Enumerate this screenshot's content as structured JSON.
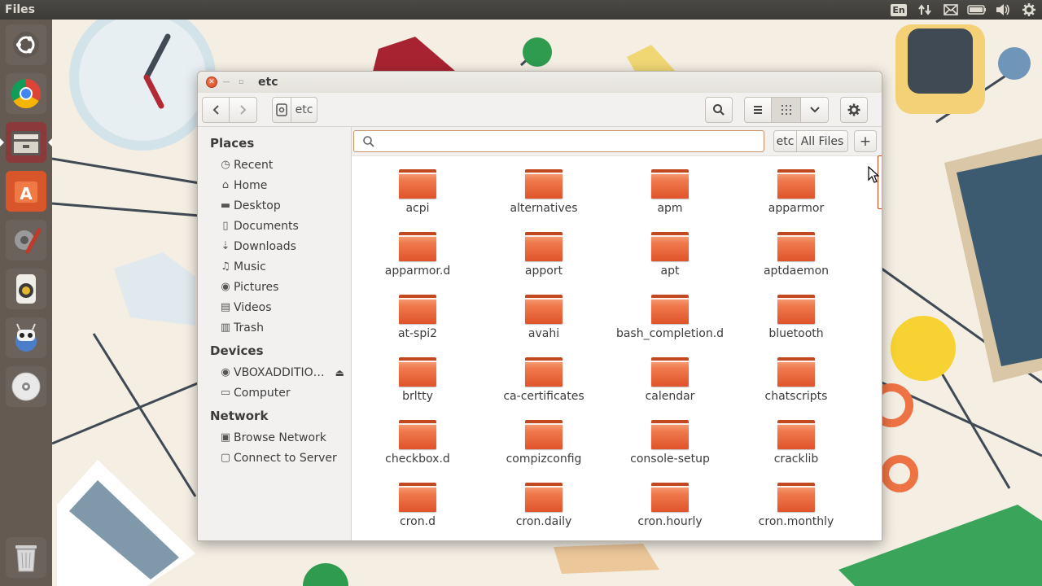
{
  "panel": {
    "app_name": "Files",
    "keyboard_layout": "En"
  },
  "panel_icons": [
    "transfer-arrows-icon",
    "mail-icon",
    "battery-icon",
    "volume-icon",
    "power-gear-icon"
  ],
  "launcher": {
    "items": [
      {
        "name": "ubuntu-dash-icon"
      },
      {
        "name": "chrome-icon"
      },
      {
        "name": "files-icon",
        "active": true
      },
      {
        "name": "software-center-icon"
      },
      {
        "name": "system-settings-icon"
      },
      {
        "name": "rhythmbox-icon"
      },
      {
        "name": "robot-app-icon"
      },
      {
        "name": "disc-icon"
      },
      {
        "name": "trash-launcher-icon"
      }
    ]
  },
  "window": {
    "title": "etc",
    "path_label": "etc"
  },
  "sidebar": {
    "places_heading": "Places",
    "places": [
      {
        "label": "Recent",
        "icon": "recent-icon"
      },
      {
        "label": "Home",
        "icon": "home-icon"
      },
      {
        "label": "Desktop",
        "icon": "desktop-icon"
      },
      {
        "label": "Documents",
        "icon": "documents-icon"
      },
      {
        "label": "Downloads",
        "icon": "downloads-icon"
      },
      {
        "label": "Music",
        "icon": "music-icon"
      },
      {
        "label": "Pictures",
        "icon": "pictures-icon"
      },
      {
        "label": "Videos",
        "icon": "videos-icon"
      },
      {
        "label": "Trash",
        "icon": "trash-icon"
      }
    ],
    "devices_heading": "Devices",
    "devices": [
      {
        "label": "VBOXADDITIO…",
        "icon": "optical-drive-icon"
      },
      {
        "label": "Computer",
        "icon": "computer-icon"
      }
    ],
    "network_heading": "Network",
    "network": [
      {
        "label": "Browse Network",
        "icon": "network-icon"
      },
      {
        "label": "Connect to Server",
        "icon": "server-icon"
      }
    ]
  },
  "search": {
    "placeholder": "",
    "scope_current": "etc",
    "scope_all": "All Files",
    "add_label": "+"
  },
  "files": [
    "acpi",
    "alternatives",
    "apm",
    "apparmor",
    "apparmor.d",
    "apport",
    "apt",
    "aptdaemon",
    "at-spi2",
    "avahi",
    "bash_completion.d",
    "bluetooth",
    "brltty",
    "ca-certificates",
    "calendar",
    "chatscripts",
    "checkbox.d",
    "compizconfig",
    "console-setup",
    "cracklib",
    "cron.d",
    "cron.daily",
    "cron.hourly",
    "cron.monthly"
  ],
  "colors": {
    "folder": "#ef7a4d",
    "accent": "#dd4814",
    "panel": "#3c3b37"
  }
}
